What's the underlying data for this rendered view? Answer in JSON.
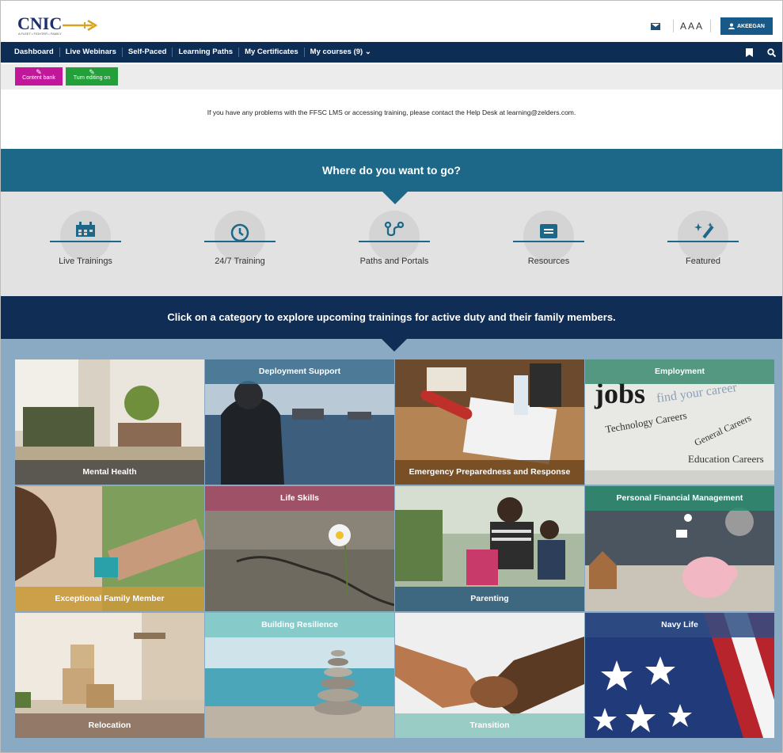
{
  "header": {
    "logo_text": "CNIC",
    "logo_tagline": "A FLEET • FIGHTER • FAMILY",
    "aaa": "AAA",
    "user_label": "AKEEGAN"
  },
  "nav": {
    "items": [
      "Dashboard",
      "Live Webinars",
      "Self-Paced",
      "Learning Paths",
      "My Certificates",
      "My courses (9)"
    ]
  },
  "toolbar": {
    "content_bank": "Content bank",
    "turn_editing_on": "Turn editing on"
  },
  "notice": "If you have any problems with the FFSC LMS or accessing training, please contact the Help Desk at learning@zelders.com.",
  "where": {
    "title": "Where do you want to go?",
    "items": [
      {
        "label": "Live Trainings",
        "icon": "calendar-icon"
      },
      {
        "label": "24/7 Training",
        "icon": "clock-icon"
      },
      {
        "label": "Paths and Portals",
        "icon": "route-icon"
      },
      {
        "label": "Resources",
        "icon": "document-icon"
      },
      {
        "label": "Featured",
        "icon": "sparkle-wand-icon"
      }
    ]
  },
  "categories": {
    "title": "Click on a category to explore upcoming trainings for active duty and their family members.",
    "tiles": [
      {
        "label": "Mental Health",
        "label_color": "#4c4c4c"
      },
      {
        "label": "Deployment Support",
        "label_color": "#3a6d8c"
      },
      {
        "label": "Emergency Preparedness and Response",
        "label_color": "#7a4a1e"
      },
      {
        "label": "Employment",
        "label_color": "#3a8a70"
      },
      {
        "label": "Exceptional Family Member",
        "label_color": "#c99a3b"
      },
      {
        "label": "Life Skills",
        "label_color": "#a04a64"
      },
      {
        "label": "Parenting",
        "label_color": "#2f5c7a"
      },
      {
        "label": "Personal Financial Management",
        "label_color": "#2e8a6e"
      },
      {
        "label": "Relocation",
        "label_color": "#8a6e5c"
      },
      {
        "label": "Building Resilience",
        "label_color": "#7ec6c6"
      },
      {
        "label": "Transition",
        "label_color": "#8ec8c0"
      },
      {
        "label": "Navy Life",
        "label_color": "#2f4d82"
      }
    ]
  }
}
